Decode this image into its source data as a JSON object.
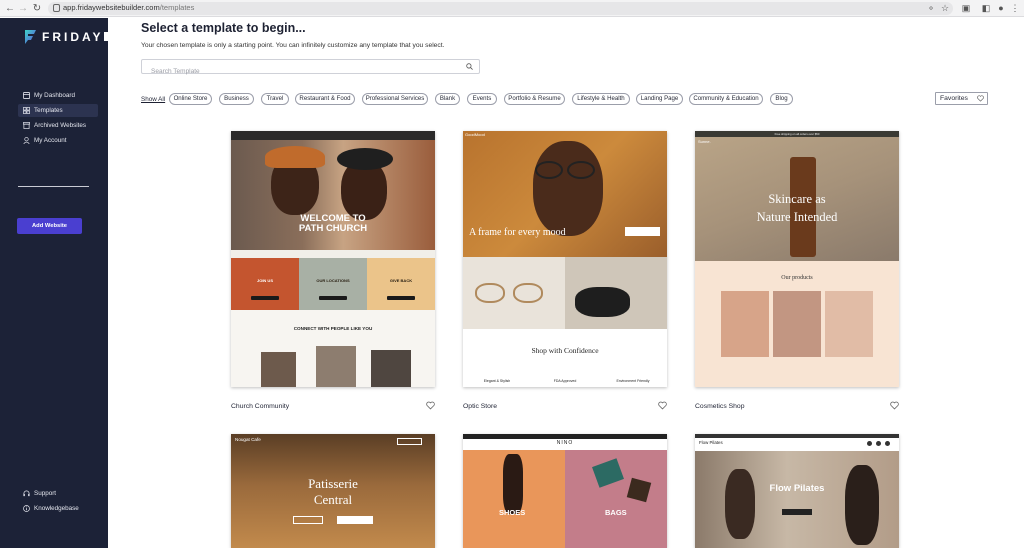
{
  "browser": {
    "url_domain": "app.fridaywebsitebuilder.com",
    "url_path": "/templates"
  },
  "sidebar": {
    "brand": "FRIDAY",
    "items": [
      {
        "label": "My Dashboard",
        "icon": "dashboard-icon",
        "active": false
      },
      {
        "label": "Templates",
        "icon": "grid-icon",
        "active": true
      },
      {
        "label": "Archived Websites",
        "icon": "archive-icon",
        "active": false
      },
      {
        "label": "My Account",
        "icon": "user-icon",
        "active": false
      }
    ],
    "add_button": "Add Website",
    "bottom_items": [
      {
        "label": "Support",
        "icon": "headset-icon"
      },
      {
        "label": "Knowledgebase",
        "icon": "info-icon"
      }
    ]
  },
  "main": {
    "title": "Select a template to begin...",
    "subtitle": "Your chosen template is only a starting point. You can infinitely customize any template that you select.",
    "search_placeholder": "Search Template",
    "show_all": "Show All",
    "categories": [
      "Online Store",
      "Business",
      "Travel",
      "Restaurant & Food",
      "Professional Services",
      "Blank",
      "Events",
      "Portfolio & Resume",
      "Lifestyle & Health",
      "Landing Page",
      "Community & Education",
      "Blog"
    ],
    "favorites_label": "Favorites"
  },
  "templates": [
    {
      "name": "Church Community",
      "hero_title_1": "WELCOME TO",
      "hero_title_2": "PATH CHURCH",
      "tiles": [
        "JOIN US",
        "OUR LOCATIONS",
        "GIVE BACK"
      ],
      "footer_text": "CONNECT WITH PEOPLE LIKE YOU"
    },
    {
      "name": "Optic Store",
      "brand": "GoodMood",
      "hero_title": "A frame for every mood",
      "section_title": "Shop with Confidence",
      "features": [
        "Elegant & Stylish",
        "FDA Approved",
        "Environment Friendly"
      ]
    },
    {
      "name": "Cosmetics Shop",
      "brand": "Sunne.",
      "promo": "Free shipping on all orders over $50",
      "hero_title_1": "Skincare as",
      "hero_title_2": "Nature Intended",
      "section_title": "Our products"
    },
    {
      "name": "Nougat Cafe",
      "brand": "Nougat Cafe",
      "hero_title_1": "Patisserie",
      "hero_title_2": "Central"
    },
    {
      "name": "NINO",
      "brand": "NINO",
      "label_left": "SHOES",
      "label_right": "BAGS"
    },
    {
      "name": "Flow Pilates",
      "brand": "Flow Pilates",
      "hero_title": "Flow Pilates"
    }
  ],
  "colors": {
    "sidebar_bg": "#1c2237",
    "accent": "#4a3fd0",
    "logo_gradient": [
      "#3fd6c8",
      "#5b4bdb"
    ]
  }
}
